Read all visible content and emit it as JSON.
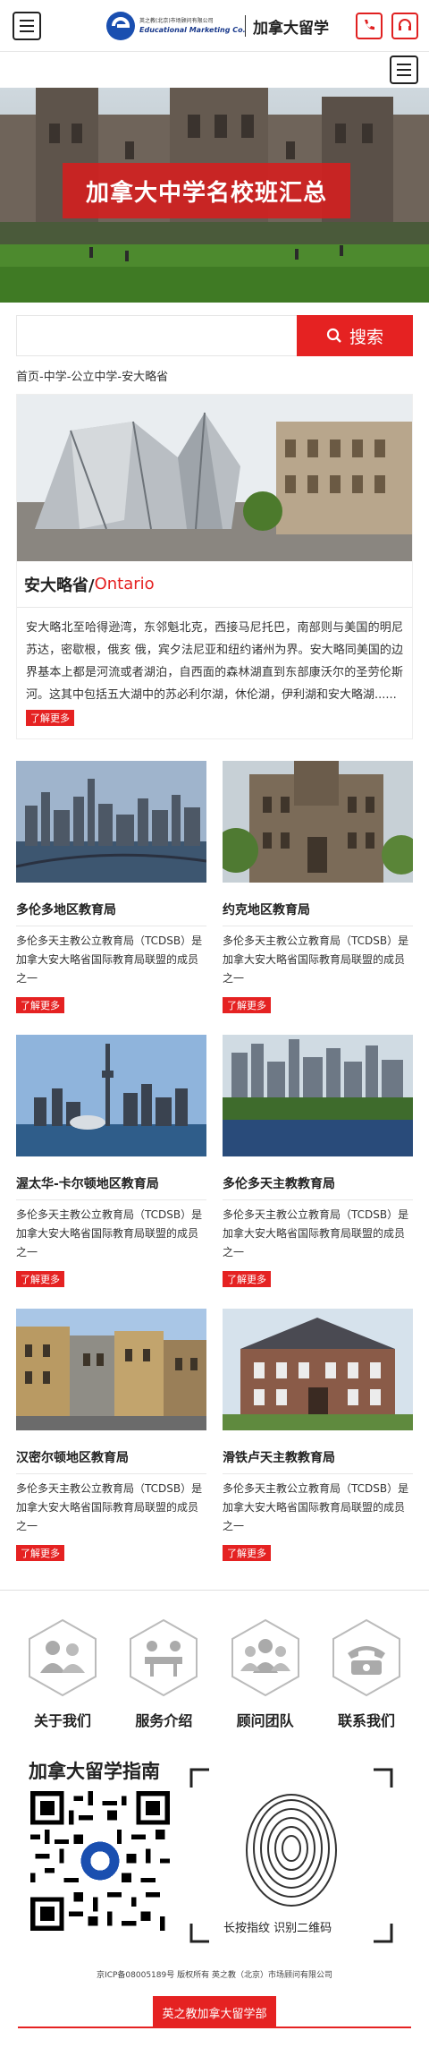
{
  "header": {
    "logo_small": "英之教(北京)市场顾问有限公司",
    "logo_en": "Educational Marketing Co.",
    "site_title": "加拿大留学"
  },
  "banner": {
    "title": "加拿大中学名校班汇总"
  },
  "search": {
    "placeholder": "",
    "button_label": "搜索"
  },
  "breadcrumb": "首页-中学-公立中学-安大略省",
  "province": {
    "name_cn": "安大略省/",
    "name_en": "Ontario",
    "description": "安大略北至哈得逊湾，东邻魁北克，西接马尼托巴，南部则与美国的明尼苏达，密歇根，俄亥 俄，宾夕法尼亚和纽约诸州为界。安大略同美国的边界基本上都是河流或者湖泊，自西面的森林湖直到东部康沃尔的圣劳伦斯河。这其中包括五大湖中的苏必利尔湖，休伦湖，伊利湖和安大略湖......",
    "more_label": "了解更多"
  },
  "boards": [
    {
      "title": "多伦多地区教育局",
      "desc": "多伦多天主教公立教育局（TCDSB）是加拿大安大略省国际教育局联盟的成员之一",
      "more": "了解更多"
    },
    {
      "title": "约克地区教育局",
      "desc": "多伦多天主教公立教育局（TCDSB）是加拿大安大略省国际教育局联盟的成员之一",
      "more": "了解更多"
    },
    {
      "title": "渥太华-卡尔顿地区教育局",
      "desc": "多伦多天主教公立教育局（TCDSB）是加拿大安大略省国际教育局联盟的成员之一",
      "more": "了解更多"
    },
    {
      "title": "多伦多天主教教育局",
      "desc": "多伦多天主教公立教育局（TCDSB）是加拿大安大略省国际教育局联盟的成员之一",
      "more": "了解更多"
    },
    {
      "title": "汉密尔顿地区教育局",
      "desc": "多伦多天主教公立教育局（TCDSB）是加拿大安大略省国际教育局联盟的成员之一",
      "more": "了解更多"
    },
    {
      "title": "滑铁卢天主教教育局",
      "desc": "多伦多天主教公立教育局（TCDSB）是加拿大安大略省国际教育局联盟的成员之一",
      "more": "了解更多"
    }
  ],
  "nav": [
    {
      "label": "关于我们",
      "icon": "people-icon"
    },
    {
      "label": "服务介绍",
      "icon": "meeting-icon"
    },
    {
      "label": "顾问团队",
      "icon": "team-icon"
    },
    {
      "label": "联系我们",
      "icon": "phone-icon"
    }
  ],
  "qr": {
    "title": "加拿大留学指南",
    "caption": "长按指纹 识别二维码"
  },
  "footer": {
    "copyright": "京ICP备08005189号 版权所有 英之教（北京）市场顾问有限公司",
    "button_label": "英之教加拿大留学部"
  },
  "colors": {
    "accent": "#e52222"
  }
}
